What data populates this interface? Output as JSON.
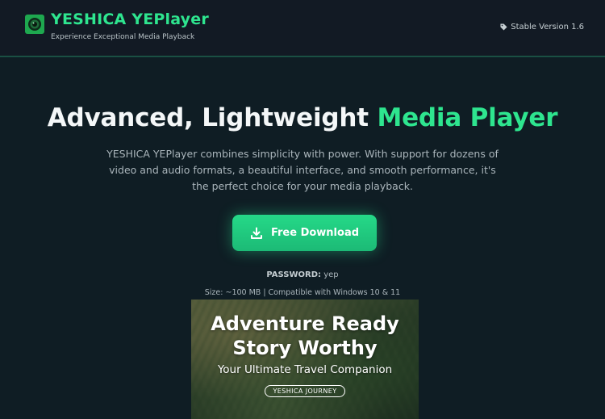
{
  "header": {
    "brand_title": "YESHICA YEPlayer",
    "tagline": "Experience Exceptional Media Playback",
    "version": "Stable Version 1.6",
    "logo_icon": "camera-lens-icon",
    "version_icon": "tag-icon"
  },
  "hero": {
    "title_main": "Advanced, Lightweight ",
    "title_accent": "Media Player",
    "description": "YESHICA YEPlayer combines simplicity with power. With support for dozens of video and audio formats, a beautiful interface, and smooth performance, it's the perfect choice for your media playback.",
    "download_label": "Free Download",
    "download_icon": "download-icon",
    "password_label": "PASSWORD:",
    "password_value": "yep",
    "size_info": "Size: ~100 MB | Compatible with Windows 10 & 11"
  },
  "banner": {
    "headline_line1": "Adventure Ready",
    "headline_line2": "Story Worthy",
    "subtitle": "Your Ultimate Travel Companion",
    "badge": "YESHICA JOURNEY"
  },
  "colors": {
    "accent": "#2ee58f",
    "background": "#0f1d24",
    "header_bg": "#121a24",
    "button": "#22c97e"
  }
}
